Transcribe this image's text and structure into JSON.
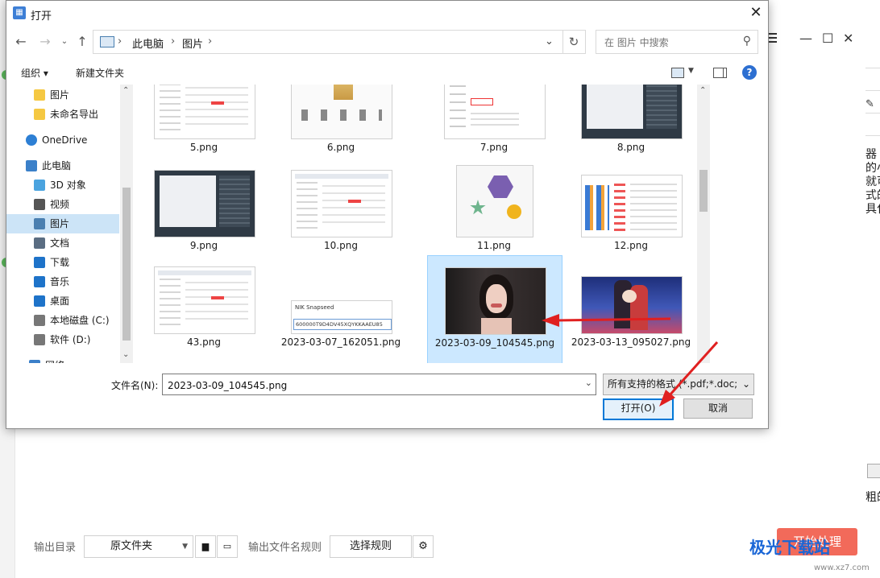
{
  "dialog": {
    "title": "打开",
    "close_glyph": "✕",
    "nav": {
      "back": "←",
      "forward": "→",
      "up": "↑",
      "recent": "⌄"
    },
    "address": {
      "items": [
        "此电脑",
        "›",
        "图片",
        "›"
      ],
      "sep": "›",
      "drop": "⌄",
      "refresh": "↻"
    },
    "search_placeholder": "在 图片 中搜索",
    "toolbar": {
      "organize": "组织 ▾",
      "new_folder": "新建文件夹",
      "help": "?"
    },
    "nav_pane": [
      {
        "label": "图片",
        "icon": "folder-icon",
        "color": "#f5c842",
        "selected": false
      },
      {
        "label": "未命名导出",
        "icon": "folder-icon",
        "color": "#f5c842",
        "selected": false
      },
      {
        "label": "OneDrive",
        "icon": "cloud-icon",
        "color": "#2d7fd4",
        "selected": false
      },
      {
        "label": "此电脑",
        "icon": "computer-icon",
        "color": "#3b80c9",
        "selected": false
      },
      {
        "label": "3D 对象",
        "icon": "cube-icon",
        "color": "#4aa3df",
        "selected": false
      },
      {
        "label": "视频",
        "icon": "video-icon",
        "color": "#555555",
        "selected": false
      },
      {
        "label": "图片",
        "icon": "picture-icon",
        "color": "#4a7fb0",
        "selected": true
      },
      {
        "label": "文档",
        "icon": "document-icon",
        "color": "#5a6d82",
        "selected": false
      },
      {
        "label": "下载",
        "icon": "download-icon",
        "color": "#1e73c9",
        "selected": false
      },
      {
        "label": "音乐",
        "icon": "music-icon",
        "color": "#1e73c9",
        "selected": false
      },
      {
        "label": "桌面",
        "icon": "desktop-icon",
        "color": "#1e73c9",
        "selected": false
      },
      {
        "label": "本地磁盘 (C:)",
        "icon": "drive-icon",
        "color": "#777777",
        "selected": false
      },
      {
        "label": "软件 (D:)",
        "icon": "drive-icon",
        "color": "#777777",
        "selected": false
      },
      {
        "label": "网络",
        "icon": "network-icon",
        "color": "#3b80c9",
        "selected": false
      }
    ],
    "files": [
      {
        "name": "5.png",
        "kind": "ui-light"
      },
      {
        "name": "6.png",
        "kind": "ui-gold"
      },
      {
        "name": "7.png",
        "kind": "ui-form"
      },
      {
        "name": "8.png",
        "kind": "ui-dark"
      },
      {
        "name": "9.png",
        "kind": "ui-dark"
      },
      {
        "name": "10.png",
        "kind": "ui-light"
      },
      {
        "name": "11.png",
        "kind": "shapes"
      },
      {
        "name": "12.png",
        "kind": "ui-icons"
      },
      {
        "name": "43.png",
        "kind": "ui-light"
      },
      {
        "name": "2023-03-07_162051.png",
        "kind": "snapseed"
      },
      {
        "name": "2023-03-09_104545.png",
        "kind": "portrait",
        "selected": true
      },
      {
        "name": "2023-03-13_095027.png",
        "kind": "anime"
      }
    ],
    "snapseed_title": "NIK Snapseed",
    "snapseed_code": "600000T9D4DV45XQYKKAAEU85",
    "filename_label": "文件名(N):",
    "filename_value": "2023-03-09_104545.png",
    "filename_drop": "⌄",
    "filter_value": "所有支持的格式 (*.pdf;*.doc;*.",
    "filter_drop": "⌄",
    "open_button": "打开(O)",
    "cancel_button": "取消",
    "scroll_up": "⌃",
    "scroll_down": "⌄"
  },
  "background": {
    "win_min": "—",
    "win_max": "☐",
    "win_close": "✕",
    "side_text": [
      "器",
      "的小",
      "就可",
      "式的",
      "具化"
    ],
    "side_text_lower": "粗的",
    "output_dir_label": "输出目录",
    "output_dir_value": "原文件夹",
    "output_rule_label": "输出文件名规则",
    "select_rule_button": "选择规则",
    "start_button": "开始处理",
    "watermark": "极光下载站",
    "watermark_sub": "www.xz7.com"
  }
}
